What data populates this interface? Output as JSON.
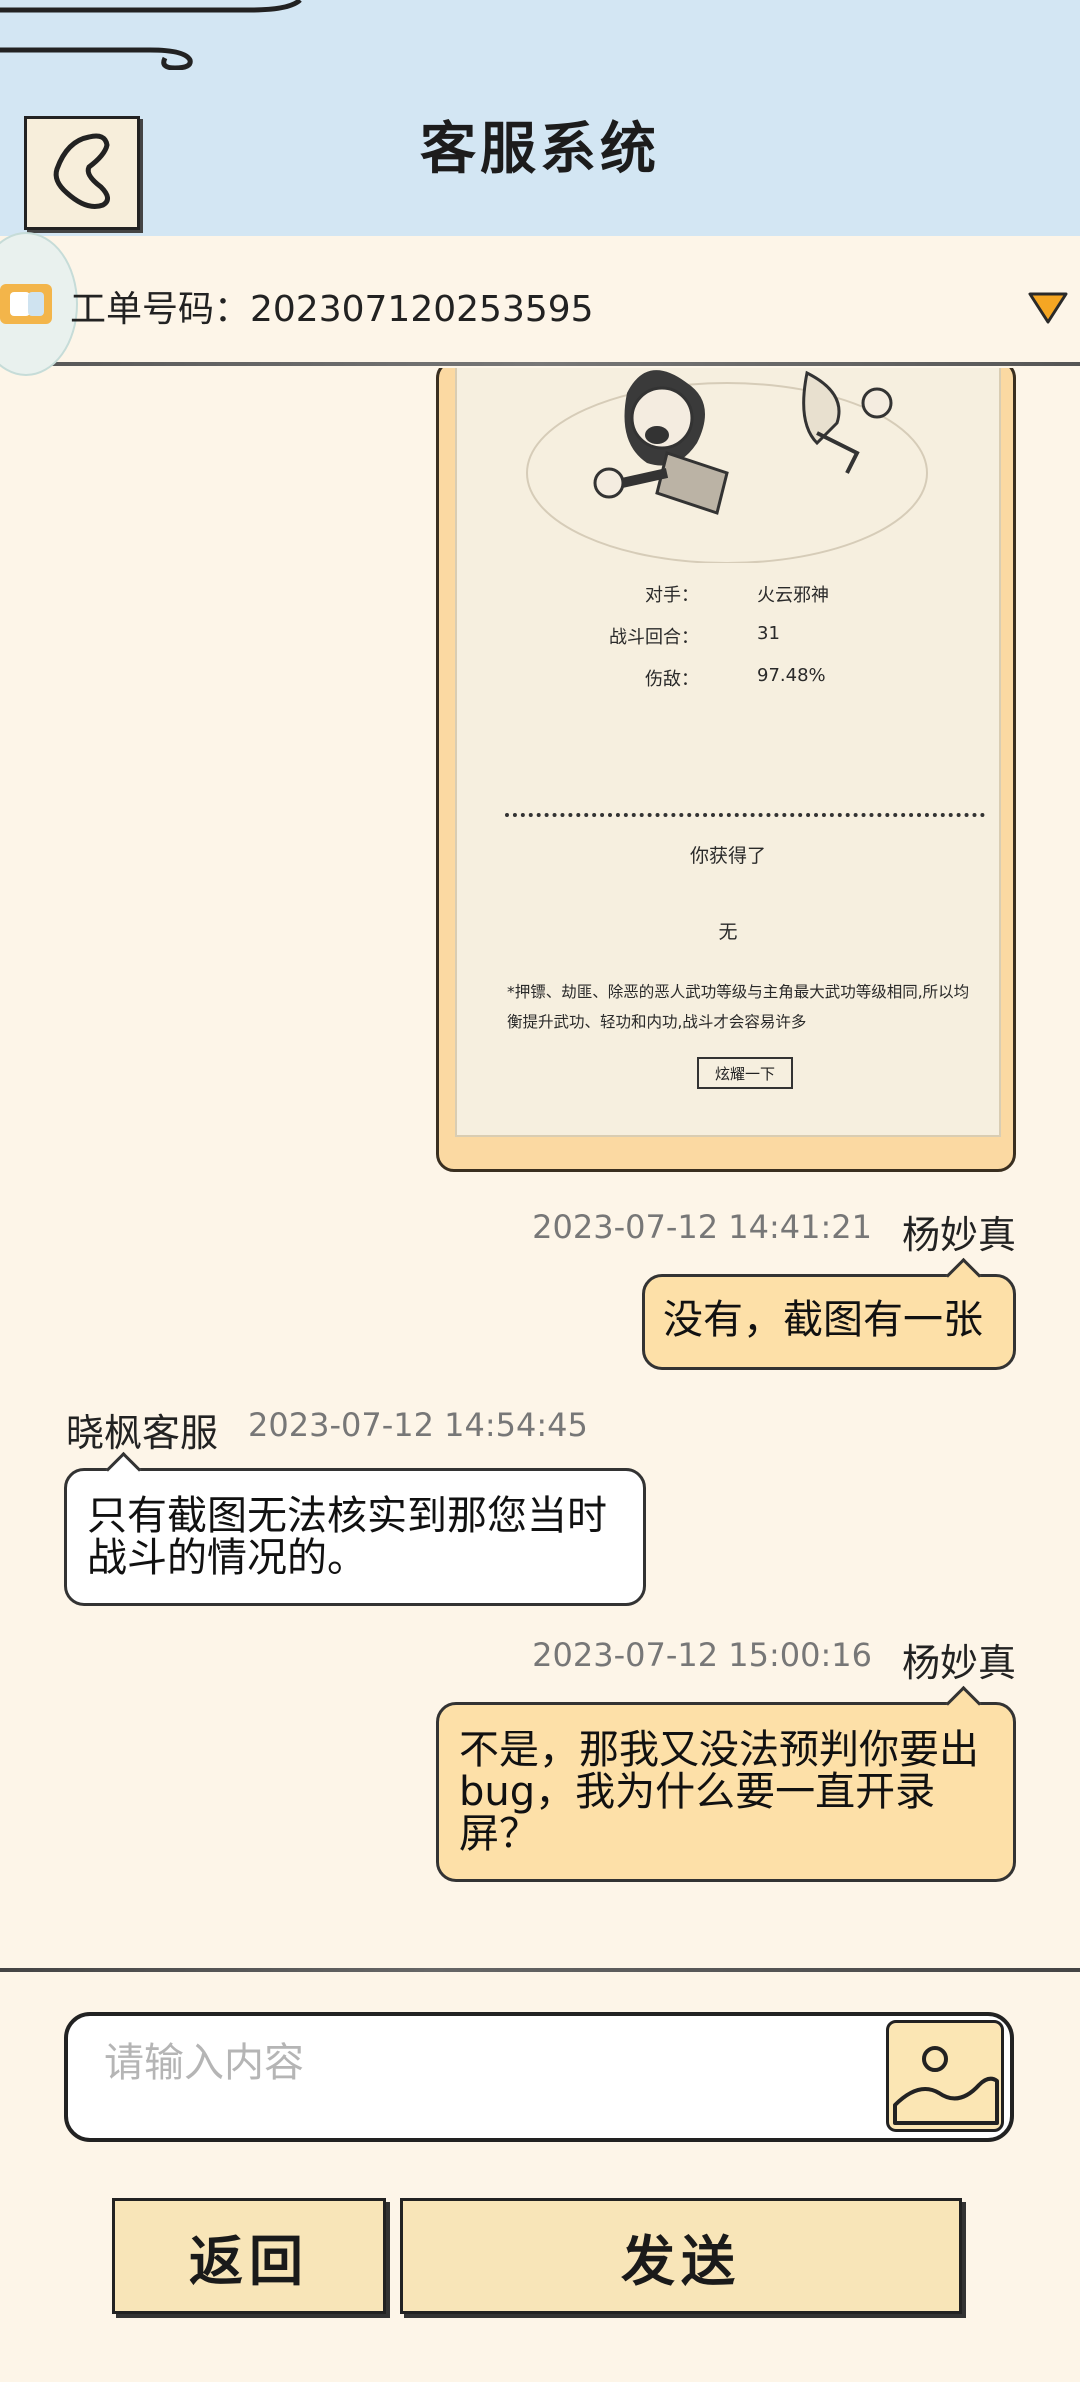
{
  "header": {
    "title": "客服系统",
    "back_icon": "chevron-left-icon"
  },
  "ticket": {
    "label": "工单号码：202307120253595",
    "dropdown_icon": "triangle-down-icon",
    "dropdown_color": "#f5a623"
  },
  "screenshot": {
    "stats": [
      {
        "label": "对手：",
        "value": "火云邪神"
      },
      {
        "label": "战斗回合：",
        "value": "31"
      },
      {
        "label": "伤敌：",
        "value": "97.48%"
      }
    ],
    "gain_title": "你获得了",
    "gain_value": "无",
    "tip": "*押镖、劫匪、除恶的恶人武功等级与主角最大武功等级相同,所以均衡提升武功、轻功和内功,战斗才会容易许多",
    "show_off_label": "炫耀一下"
  },
  "messages": [
    {
      "sender": "杨妙真",
      "time": "2023-07-12 14:41:21",
      "text": "没有，截图有一张",
      "side": "mine"
    },
    {
      "sender": "晓枫客服",
      "time": "2023-07-12 14:54:45",
      "text": "只有截图无法核实到那您当时战斗的情况的。",
      "side": "theirs"
    },
    {
      "sender": "杨妙真",
      "time": "2023-07-12 15:00:16",
      "text": "不是，那我又没法预判你要出bug，我为什么要一直开录屏？",
      "side": "mine"
    }
  ],
  "composer": {
    "placeholder": "请输入内容",
    "image_icon": "image-icon"
  },
  "footer": {
    "back_label": "返回",
    "send_label": "发送"
  },
  "colors": {
    "header_bg": "#d3e6f3",
    "page_bg": "#fdf5e8",
    "my_bubble": "#fde0a8",
    "their_bubble": "#ffffff"
  }
}
